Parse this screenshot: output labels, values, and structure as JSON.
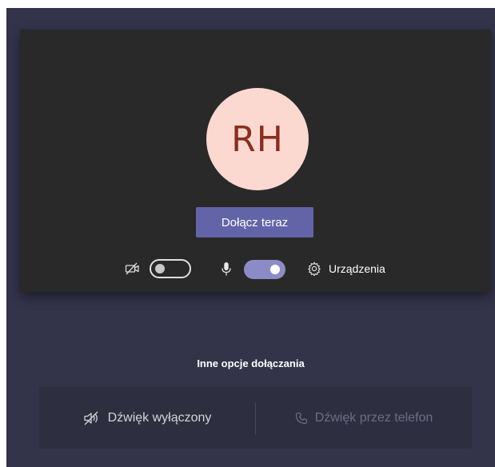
{
  "preview": {
    "avatar_initials": "RH",
    "join_button_label": "Dołącz teraz",
    "controls": {
      "video_toggle": "off",
      "mic_toggle": "on",
      "devices_label": "Urządzenia"
    }
  },
  "other_options": {
    "title": "Inne opcje dołączania",
    "audio_off_label": "Dźwięk wyłączony",
    "phone_audio_label": "Dźwięk przez telefon"
  },
  "colors": {
    "app_background": "#33344a",
    "preview_background": "#292929",
    "avatar_background": "#fbd9d0",
    "avatar_text": "#8b2e1f",
    "accent": "#6264a7",
    "toggle_on": "#8b8cc7"
  },
  "icons": [
    "video-off-icon",
    "microphone-icon",
    "gear-icon",
    "speaker-off-icon",
    "phone-icon"
  ]
}
